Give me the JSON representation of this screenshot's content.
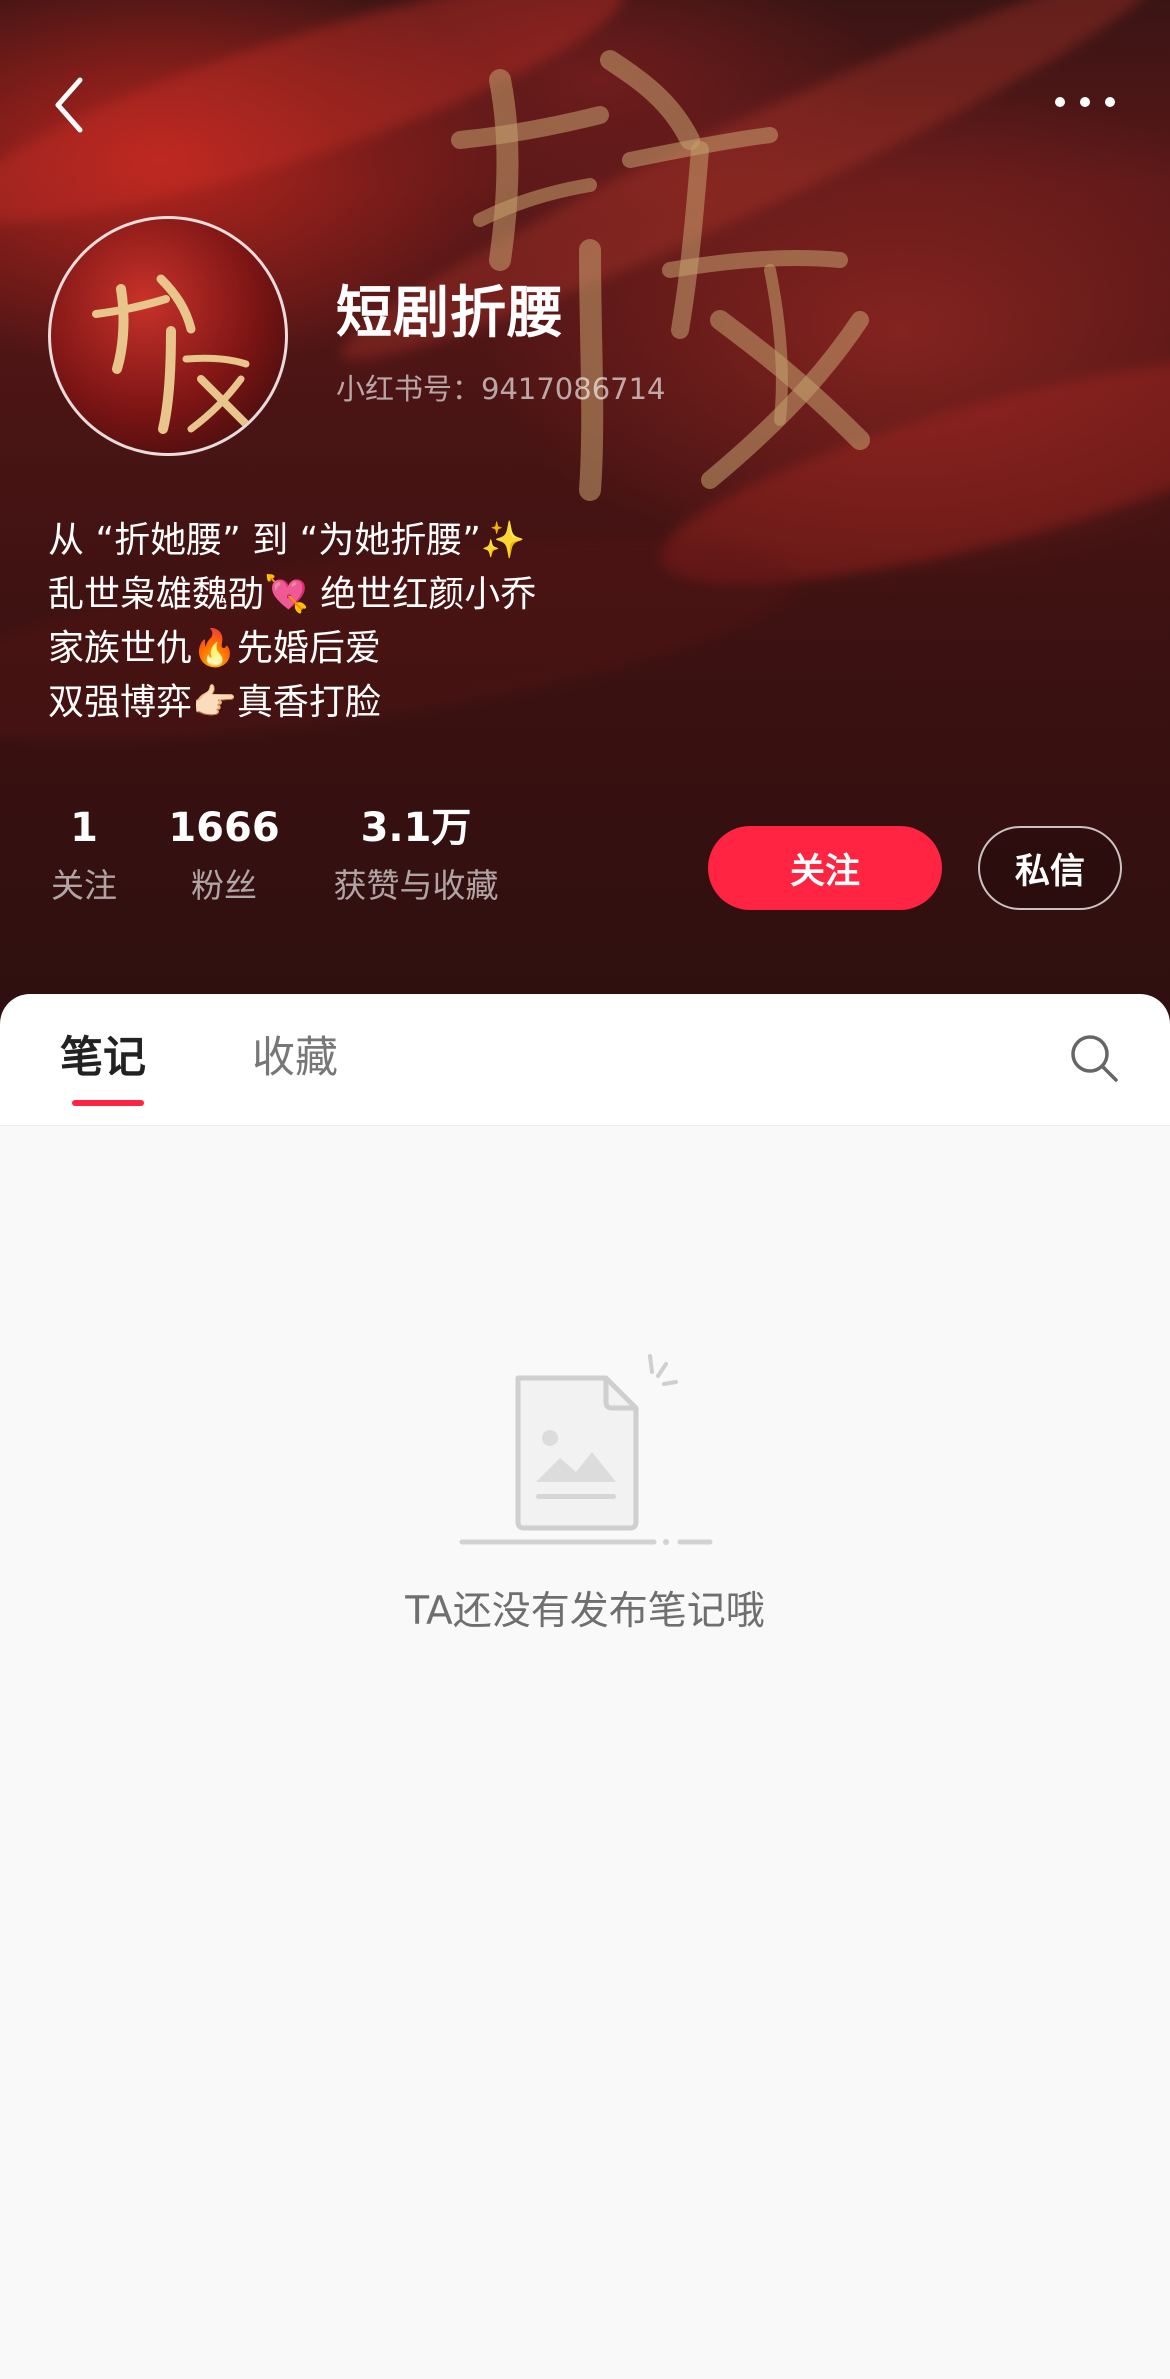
{
  "header": {
    "back_icon": "chevron-left-icon",
    "more_icon": "more-horizontal-icon"
  },
  "profile": {
    "name": "短剧折腰",
    "account_id": "小红书号：9417086714",
    "bio": [
      "从 “折她腰” 到 “为她折腰”✨",
      "乱世枭雄魏劭💘 绝世红颜小乔",
      "家族世仇🔥先婚后爱",
      "双强博弈👉🏻真香打脸"
    ]
  },
  "stats": {
    "following": {
      "value": "1",
      "label": "关注"
    },
    "followers": {
      "value": "1666",
      "label": "粉丝"
    },
    "likes": {
      "value": "3.1万",
      "label": "获赞与收藏"
    }
  },
  "actions": {
    "follow_label": "关注",
    "message_label": "私信"
  },
  "tabs": [
    {
      "label": "笔记",
      "active": true
    },
    {
      "label": "收藏",
      "active": false
    }
  ],
  "empty_state": {
    "message": "TA还没有发布笔记哦"
  },
  "colors": {
    "accent": "#ff2442",
    "banner_dark": "#3b1111",
    "background": "#f9f9f9"
  }
}
